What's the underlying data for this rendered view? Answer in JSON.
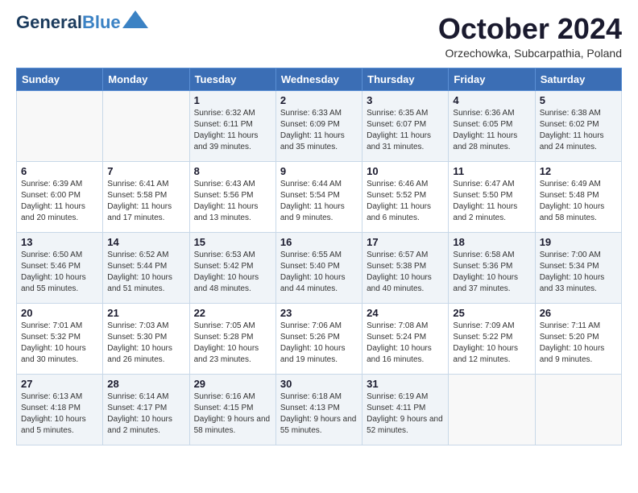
{
  "logo": {
    "line1": "General",
    "line2": "Blue"
  },
  "header": {
    "month": "October 2024",
    "location": "Orzechowka, Subcarpathia, Poland"
  },
  "days_of_week": [
    "Sunday",
    "Monday",
    "Tuesday",
    "Wednesday",
    "Thursday",
    "Friday",
    "Saturday"
  ],
  "weeks": [
    [
      {
        "day": "",
        "info": ""
      },
      {
        "day": "",
        "info": ""
      },
      {
        "day": "1",
        "info": "Sunrise: 6:32 AM\nSunset: 6:11 PM\nDaylight: 11 hours and 39 minutes."
      },
      {
        "day": "2",
        "info": "Sunrise: 6:33 AM\nSunset: 6:09 PM\nDaylight: 11 hours and 35 minutes."
      },
      {
        "day": "3",
        "info": "Sunrise: 6:35 AM\nSunset: 6:07 PM\nDaylight: 11 hours and 31 minutes."
      },
      {
        "day": "4",
        "info": "Sunrise: 6:36 AM\nSunset: 6:05 PM\nDaylight: 11 hours and 28 minutes."
      },
      {
        "day": "5",
        "info": "Sunrise: 6:38 AM\nSunset: 6:02 PM\nDaylight: 11 hours and 24 minutes."
      }
    ],
    [
      {
        "day": "6",
        "info": "Sunrise: 6:39 AM\nSunset: 6:00 PM\nDaylight: 11 hours and 20 minutes."
      },
      {
        "day": "7",
        "info": "Sunrise: 6:41 AM\nSunset: 5:58 PM\nDaylight: 11 hours and 17 minutes."
      },
      {
        "day": "8",
        "info": "Sunrise: 6:43 AM\nSunset: 5:56 PM\nDaylight: 11 hours and 13 minutes."
      },
      {
        "day": "9",
        "info": "Sunrise: 6:44 AM\nSunset: 5:54 PM\nDaylight: 11 hours and 9 minutes."
      },
      {
        "day": "10",
        "info": "Sunrise: 6:46 AM\nSunset: 5:52 PM\nDaylight: 11 hours and 6 minutes."
      },
      {
        "day": "11",
        "info": "Sunrise: 6:47 AM\nSunset: 5:50 PM\nDaylight: 11 hours and 2 minutes."
      },
      {
        "day": "12",
        "info": "Sunrise: 6:49 AM\nSunset: 5:48 PM\nDaylight: 10 hours and 58 minutes."
      }
    ],
    [
      {
        "day": "13",
        "info": "Sunrise: 6:50 AM\nSunset: 5:46 PM\nDaylight: 10 hours and 55 minutes."
      },
      {
        "day": "14",
        "info": "Sunrise: 6:52 AM\nSunset: 5:44 PM\nDaylight: 10 hours and 51 minutes."
      },
      {
        "day": "15",
        "info": "Sunrise: 6:53 AM\nSunset: 5:42 PM\nDaylight: 10 hours and 48 minutes."
      },
      {
        "day": "16",
        "info": "Sunrise: 6:55 AM\nSunset: 5:40 PM\nDaylight: 10 hours and 44 minutes."
      },
      {
        "day": "17",
        "info": "Sunrise: 6:57 AM\nSunset: 5:38 PM\nDaylight: 10 hours and 40 minutes."
      },
      {
        "day": "18",
        "info": "Sunrise: 6:58 AM\nSunset: 5:36 PM\nDaylight: 10 hours and 37 minutes."
      },
      {
        "day": "19",
        "info": "Sunrise: 7:00 AM\nSunset: 5:34 PM\nDaylight: 10 hours and 33 minutes."
      }
    ],
    [
      {
        "day": "20",
        "info": "Sunrise: 7:01 AM\nSunset: 5:32 PM\nDaylight: 10 hours and 30 minutes."
      },
      {
        "day": "21",
        "info": "Sunrise: 7:03 AM\nSunset: 5:30 PM\nDaylight: 10 hours and 26 minutes."
      },
      {
        "day": "22",
        "info": "Sunrise: 7:05 AM\nSunset: 5:28 PM\nDaylight: 10 hours and 23 minutes."
      },
      {
        "day": "23",
        "info": "Sunrise: 7:06 AM\nSunset: 5:26 PM\nDaylight: 10 hours and 19 minutes."
      },
      {
        "day": "24",
        "info": "Sunrise: 7:08 AM\nSunset: 5:24 PM\nDaylight: 10 hours and 16 minutes."
      },
      {
        "day": "25",
        "info": "Sunrise: 7:09 AM\nSunset: 5:22 PM\nDaylight: 10 hours and 12 minutes."
      },
      {
        "day": "26",
        "info": "Sunrise: 7:11 AM\nSunset: 5:20 PM\nDaylight: 10 hours and 9 minutes."
      }
    ],
    [
      {
        "day": "27",
        "info": "Sunrise: 6:13 AM\nSunset: 4:18 PM\nDaylight: 10 hours and 5 minutes."
      },
      {
        "day": "28",
        "info": "Sunrise: 6:14 AM\nSunset: 4:17 PM\nDaylight: 10 hours and 2 minutes."
      },
      {
        "day": "29",
        "info": "Sunrise: 6:16 AM\nSunset: 4:15 PM\nDaylight: 9 hours and 58 minutes."
      },
      {
        "day": "30",
        "info": "Sunrise: 6:18 AM\nSunset: 4:13 PM\nDaylight: 9 hours and 55 minutes."
      },
      {
        "day": "31",
        "info": "Sunrise: 6:19 AM\nSunset: 4:11 PM\nDaylight: 9 hours and 52 minutes."
      },
      {
        "day": "",
        "info": ""
      },
      {
        "day": "",
        "info": ""
      }
    ]
  ]
}
